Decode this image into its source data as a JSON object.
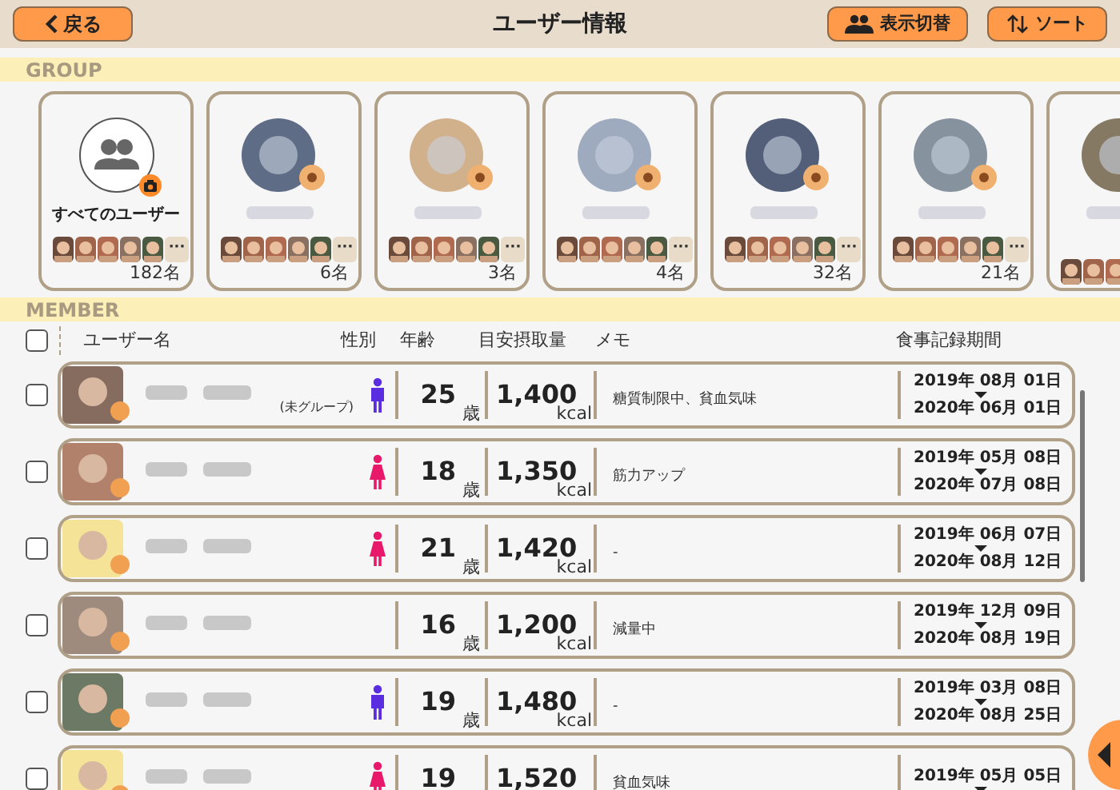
{
  "header": {
    "back": "戻る",
    "title": "ユーザー情報",
    "display_toggle": "表示切替",
    "sort": "ソート"
  },
  "group_section": {
    "label": "GROUP",
    "cards": [
      {
        "kind": "all",
        "name": "すべてのユーザー",
        "more": "···",
        "count": "182名"
      },
      {
        "kind": "group",
        "more": "···",
        "count": "6名"
      },
      {
        "kind": "group",
        "more": "···",
        "count": "3名"
      },
      {
        "kind": "group",
        "more": "···",
        "count": "4名"
      },
      {
        "kind": "group",
        "more": "···",
        "count": "32名"
      },
      {
        "kind": "group",
        "more": "···",
        "count": "21名"
      },
      {
        "kind": "group"
      }
    ]
  },
  "member_section": {
    "label": "MEMBER",
    "select_all": {
      "checked": false
    },
    "columns": [
      "ユーザー名",
      "性別",
      "年齢",
      "目安摂取量",
      "メモ",
      "食事記録期間"
    ],
    "rows": [
      {
        "checked": false,
        "group": "(未グループ)",
        "kind": "male",
        "age": "25",
        "age_unit": "歳",
        "kcal": "1,400",
        "kcal_unit": "kcal",
        "memo": "糖質制限中、貧血気味",
        "start": "2019年 08月 01日",
        "end": "2020年 06月 01日"
      },
      {
        "checked": false,
        "kind": "female",
        "age": "18",
        "age_unit": "歳",
        "kcal": "1,350",
        "kcal_unit": "kcal",
        "memo": "筋力アップ",
        "start": "2019年 05月 08日",
        "end": "2020年 07月 08日"
      },
      {
        "checked": false,
        "kind": "female",
        "age": "21",
        "age_unit": "歳",
        "kcal": "1,420",
        "kcal_unit": "kcal",
        "memo": "-",
        "start": "2019年 06月 07日",
        "end": "2020年 08月 12日"
      },
      {
        "checked": false,
        "age": "16",
        "age_unit": "歳",
        "kcal": "1,200",
        "kcal_unit": "kcal",
        "memo": "減量中",
        "start": "2019年 12月 09日",
        "end": "2020年 08月 19日"
      },
      {
        "checked": false,
        "kind": "male",
        "age": "19",
        "age_unit": "歳",
        "kcal": "1,480",
        "kcal_unit": "kcal",
        "memo": "-",
        "start": "2019年 03月 08日",
        "end": "2020年 08月 25日"
      },
      {
        "checked": false,
        "kind": "female",
        "age": "19",
        "kcal": "1,520",
        "memo": "貧血気味",
        "start": "2019年 05月 05日"
      }
    ]
  }
}
